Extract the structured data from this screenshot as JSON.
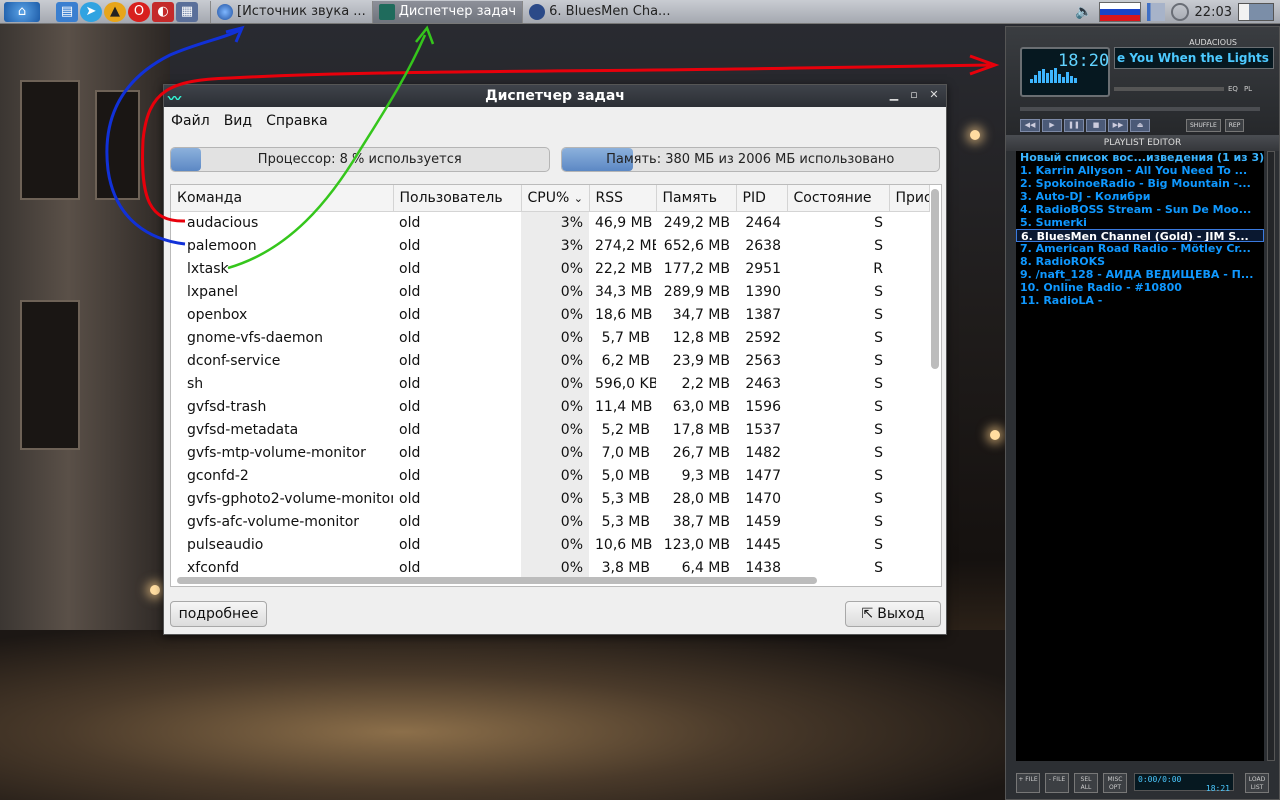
{
  "panel": {
    "tasks": [
      {
        "label": "[Источник звука ...",
        "active": false
      },
      {
        "label": "Диспетчер задач",
        "active": true
      },
      {
        "label": "6. BluesMen Cha...",
        "active": false
      }
    ],
    "clock": "22:03"
  },
  "taskmanager": {
    "title": "Диспетчер задач",
    "menu": [
      "Файл",
      "Вид",
      "Справка"
    ],
    "cpu_bar": {
      "text": "Процессор: 8 % используется",
      "fraction": 0.08
    },
    "mem_bar": {
      "text": "Память: 380 МБ из 2006 МБ использовано",
      "fraction": 0.19
    },
    "columns": [
      "Команда",
      "Пользователь",
      "CPU%",
      "RSS",
      "Память",
      "PID",
      "Состояние",
      "Прио"
    ],
    "sort_column": "CPU%",
    "rows": [
      [
        "audacious",
        "old",
        "3%",
        "46,9 MB",
        "249,2 MB",
        "2464",
        "S"
      ],
      [
        "palemoon",
        "old",
        "3%",
        "274,2 MB",
        "652,6 MB",
        "2638",
        "S"
      ],
      [
        "lxtask",
        "old",
        "0%",
        "22,2 MB",
        "177,2 MB",
        "2951",
        "R"
      ],
      [
        "lxpanel",
        "old",
        "0%",
        "34,3 MB",
        "289,9 MB",
        "1390",
        "S"
      ],
      [
        "openbox",
        "old",
        "0%",
        "18,6 MB",
        "34,7 MB",
        "1387",
        "S"
      ],
      [
        "gnome-vfs-daemon",
        "old",
        "0%",
        "5,7 MB",
        "12,8 MB",
        "2592",
        "S"
      ],
      [
        "dconf-service",
        "old",
        "0%",
        "6,2 MB",
        "23,9 MB",
        "2563",
        "S"
      ],
      [
        "sh",
        "old",
        "0%",
        "596,0 KB",
        "2,2 MB",
        "2463",
        "S"
      ],
      [
        "gvfsd-trash",
        "old",
        "0%",
        "11,4 MB",
        "63,0 MB",
        "1596",
        "S"
      ],
      [
        "gvfsd-metadata",
        "old",
        "0%",
        "5,2 MB",
        "17,8 MB",
        "1537",
        "S"
      ],
      [
        "gvfs-mtp-volume-monitor",
        "old",
        "0%",
        "7,0 MB",
        "26,7 MB",
        "1482",
        "S"
      ],
      [
        "gconfd-2",
        "old",
        "0%",
        "5,0 MB",
        "9,3 MB",
        "1477",
        "S"
      ],
      [
        "gvfs-gphoto2-volume-monitor",
        "old",
        "0%",
        "5,3 MB",
        "28,0 MB",
        "1470",
        "S"
      ],
      [
        "gvfs-afc-volume-monitor",
        "old",
        "0%",
        "5,3 MB",
        "38,7 MB",
        "1459",
        "S"
      ],
      [
        "pulseaudio",
        "old",
        "0%",
        "10,6 MB",
        "123,0 MB",
        "1445",
        "S"
      ],
      [
        "xfconfd",
        "old",
        "0%",
        "3,8 MB",
        "6,4 MB",
        "1438",
        "S"
      ]
    ],
    "details_button": "подробнее",
    "exit_button": "Выход"
  },
  "audacious": {
    "label": "AUDACIOUS",
    "time": "18:20",
    "marquee": "e You When the Lights",
    "eq_label": "EQ",
    "pl_label": "PL",
    "ctrls": [
      "◀◀",
      "▶",
      "❚❚",
      "■",
      "▶▶",
      "⏏"
    ],
    "shuffle": "SHUFFLE",
    "repeat": "REP",
    "playlist_header": "PLAYLIST EDITOR",
    "playlist_title": "Новый список вос...изведения (1 из 3)",
    "playlist": [
      "1.  Karrin Allyson - All You Need To ...",
      "2.  SpokoinoeRadio - Big Mountain -...",
      "3.  Auto-DJ - Колибри",
      "4.  RadioBOSS Stream - Sun De Moo...",
      "5.  Sumerki",
      "6.  BluesMen Channel (Gold) - JIM S...",
      "7.  American Road Radio - Mötley Cr...",
      "8.  RadioROKS",
      "9.  /naft_128 - АИДА ВЕДИЩЕВА - П...",
      "10. Online Radio - #10800",
      "11. RadioLA -"
    ],
    "selected_index": 5,
    "bottom_buttons": [
      "+ FILE",
      "- FILE",
      "SEL ALL",
      "MISC OPT"
    ],
    "list_button": "LOAD LIST",
    "mini_time": "0:00/0:00",
    "mini_time2": "18:21"
  },
  "colors": {
    "accent_blue": "#0f98ff",
    "anno_red": "#e8000b",
    "anno_blue": "#1131d8",
    "anno_green": "#35c61c"
  }
}
